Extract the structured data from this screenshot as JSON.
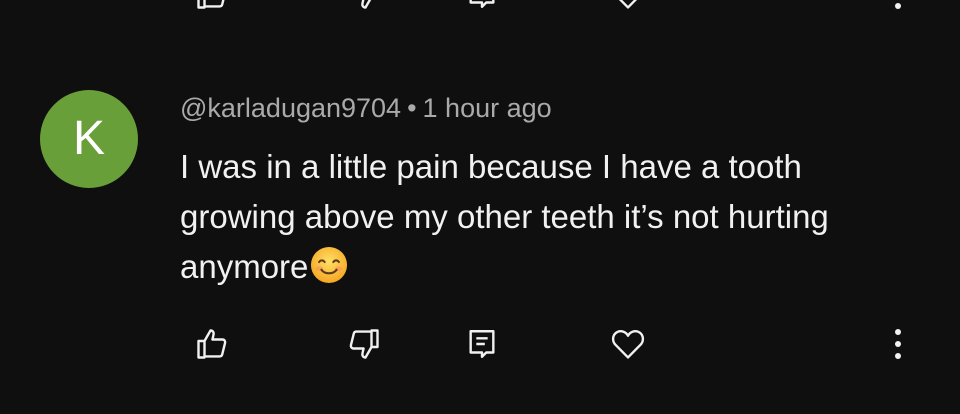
{
  "comment": {
    "avatar_letter": "K",
    "author": "@karladugan9704",
    "separator": "•",
    "time": "1 hour ago",
    "text": "I was in a little pain because I have a tooth growing above my other teeth it’s not hurting anymore",
    "emoji": "smiling-face-emoji"
  },
  "colors": {
    "background": "#0f0f0f",
    "avatar": "#689f38",
    "meta_text": "#aaaaaa",
    "body_text": "#f1f1f1",
    "icon": "#f1f1f1"
  },
  "icons": {
    "like": "thumbs-up-icon",
    "dislike": "thumbs-down-icon",
    "reply": "reply-comment-icon",
    "heart": "heart-icon",
    "more": "more-vertical-icon"
  }
}
